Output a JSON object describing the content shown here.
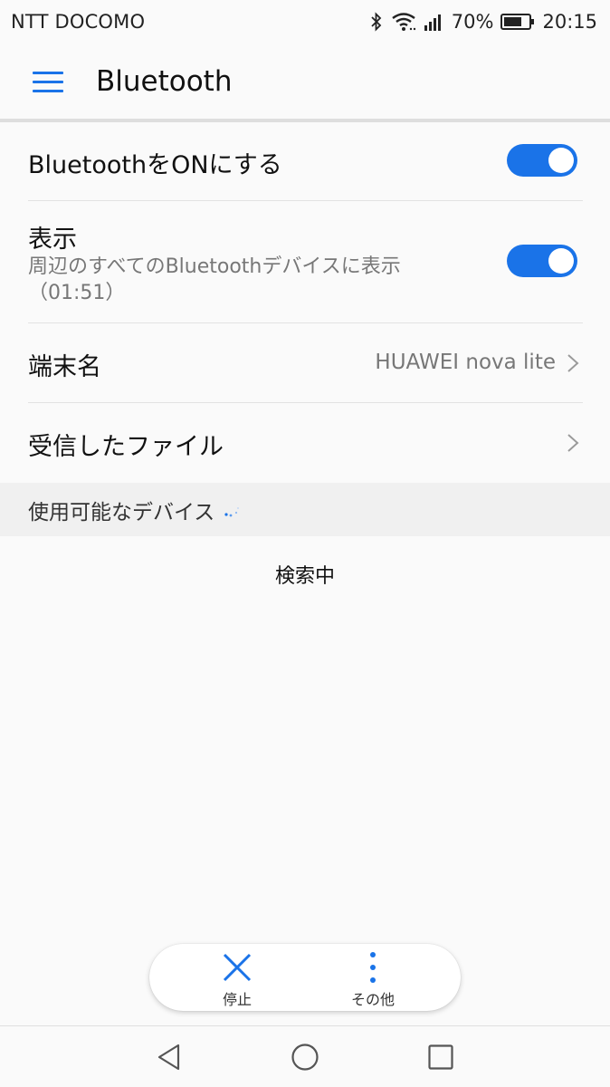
{
  "status_bar": {
    "carrier": "NTT DOCOMO",
    "battery_percent": "70%",
    "time": "20:15",
    "icons": [
      "bluetooth-icon",
      "wifi-icon",
      "signal-icon",
      "battery-icon"
    ]
  },
  "header": {
    "title": "Bluetooth",
    "menu_icon": "menu-icon",
    "accent_color": "#1a73e8"
  },
  "settings": {
    "bluetooth_on": {
      "label": "BluetoothをONにする",
      "enabled": true
    },
    "visibility": {
      "label": "表示",
      "subtitle_line1": "周辺のすべてのBluetoothデバイスに表示",
      "subtitle_line2": "（01:51）",
      "enabled": true
    },
    "device_name": {
      "label": "端末名",
      "value": "HUAWEI nova lite"
    },
    "received_files": {
      "label": "受信したファイル"
    }
  },
  "available_devices": {
    "header": "使用可能なデバイス",
    "status": "検索中"
  },
  "action_bar": {
    "stop_label": "停止",
    "more_label": "その他"
  },
  "nav_bar": {
    "icons": [
      "back-icon",
      "home-icon",
      "recents-icon"
    ]
  }
}
